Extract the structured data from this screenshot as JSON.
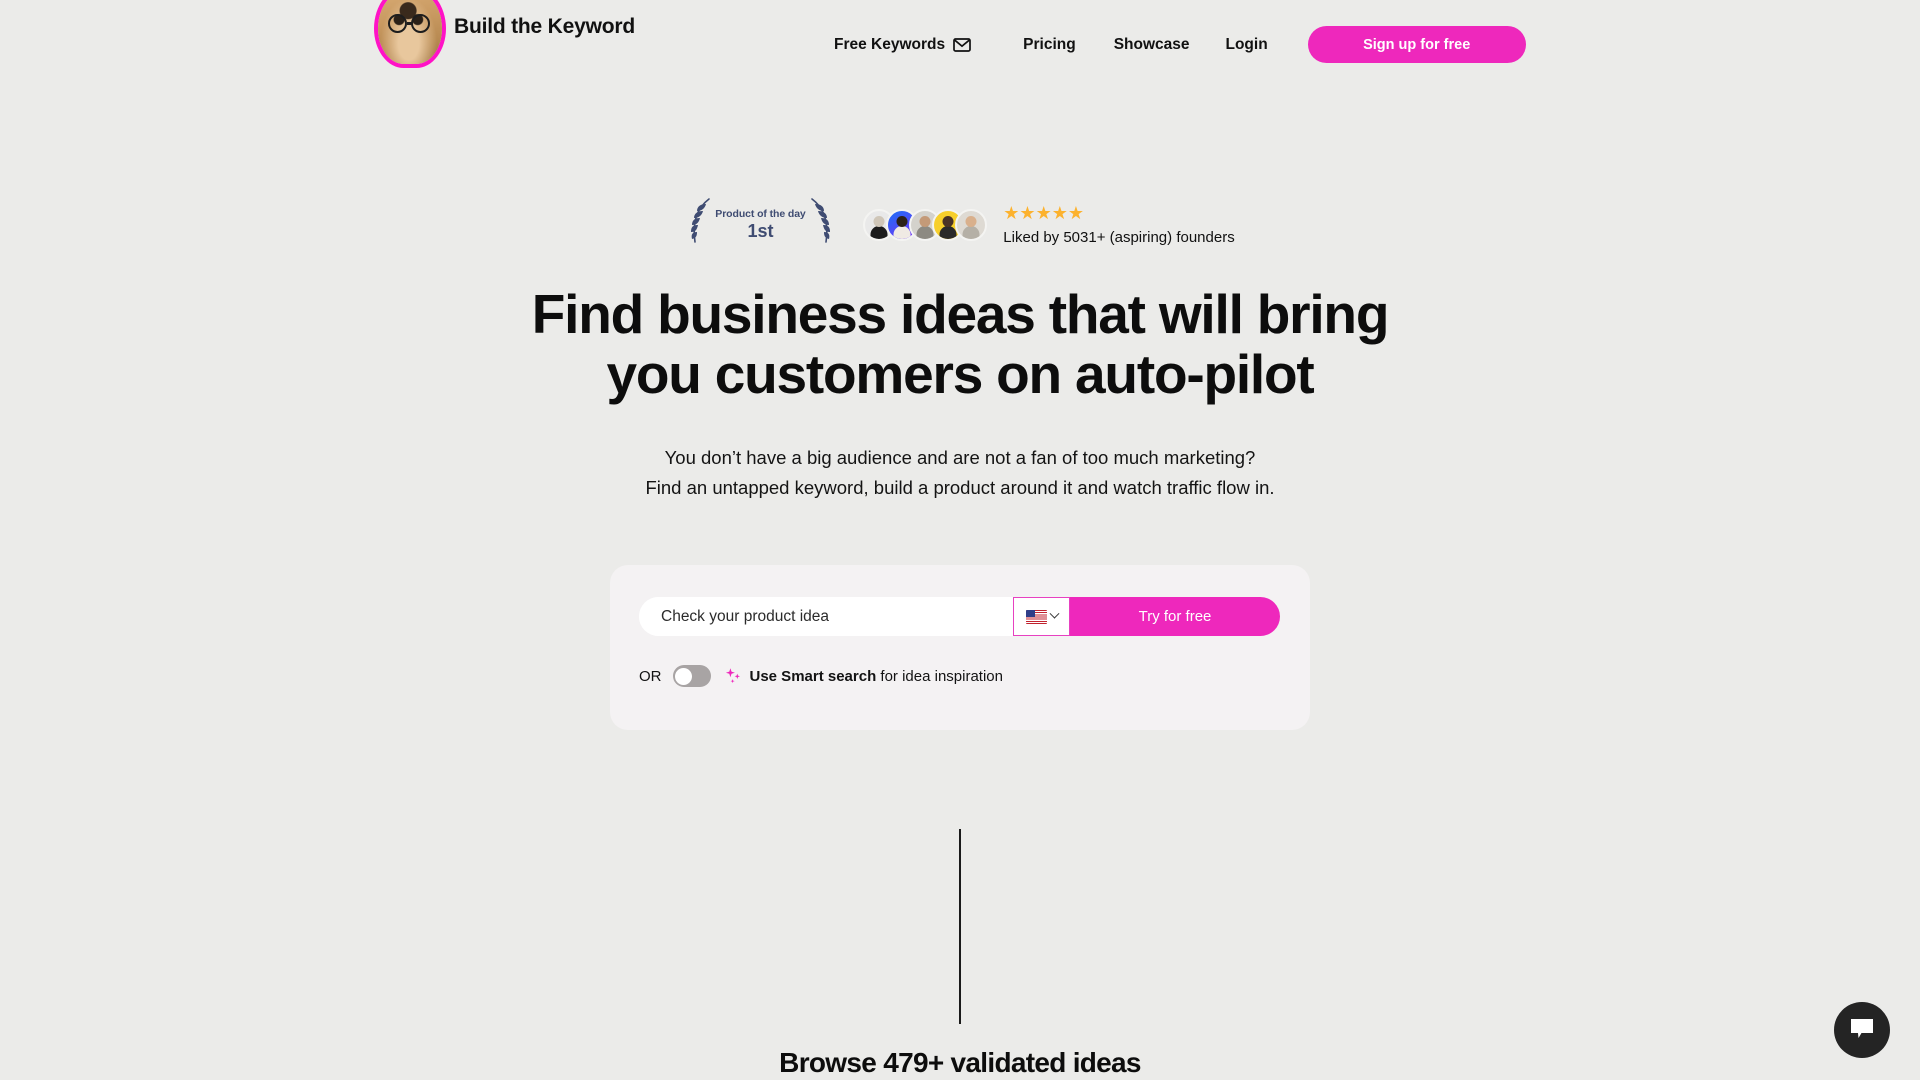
{
  "brand": {
    "name": "Build the Keyword",
    "logo_icon": "dog-with-glasses-logo"
  },
  "nav": {
    "items": [
      {
        "label": "Free Keywords",
        "icon": "mail-icon"
      },
      {
        "label": "Pricing",
        "icon": ""
      },
      {
        "label": "Showcase",
        "icon": ""
      },
      {
        "label": "Login",
        "icon": ""
      }
    ],
    "cta_label": "Sign up for free"
  },
  "social_proof": {
    "badge": {
      "top_label": "Product of the day",
      "rank": "1st",
      "left_icon": "laurel-left-icon",
      "right_icon": "laurel-right-icon",
      "color": "#3f4c72"
    },
    "avatar_count": 5,
    "stars": "★★★★★",
    "star_color": "#fcb22e",
    "liked_text": "Liked by 5031+ (aspiring) founders"
  },
  "hero": {
    "title_line1": "Find business ideas that will bring",
    "title_line2": "you customers on auto-pilot",
    "sub_line1": "You don’t have a big audience and are not a fan of too much marketing?",
    "sub_line2": "Find an untapped keyword, build a product around it and watch traffic flow in."
  },
  "search": {
    "placeholder": "Check your product idea",
    "value": "",
    "country_flag_icon": "us-flag-icon",
    "country_chevron_icon": "chevron-down-icon",
    "submit_label": "Try for free",
    "or_label": "OR",
    "toggle_state": "off",
    "sparkle_icon": "sparkles-icon",
    "smart_strong": "Use Smart search",
    "smart_rest": " for idea inspiration"
  },
  "bottom": {
    "browse_title": "Browse 479+ validated ideas"
  },
  "chat": {
    "icon": "chat-bubble-icon"
  },
  "colors": {
    "page_bg": "#ebebe9",
    "card_bg": "#f4f2f3",
    "accent_pink": "#ee28bc",
    "text": "#111111",
    "badge_navy": "#3f4c72",
    "star_gold": "#fcb22e",
    "chat_dark": "#242424"
  }
}
